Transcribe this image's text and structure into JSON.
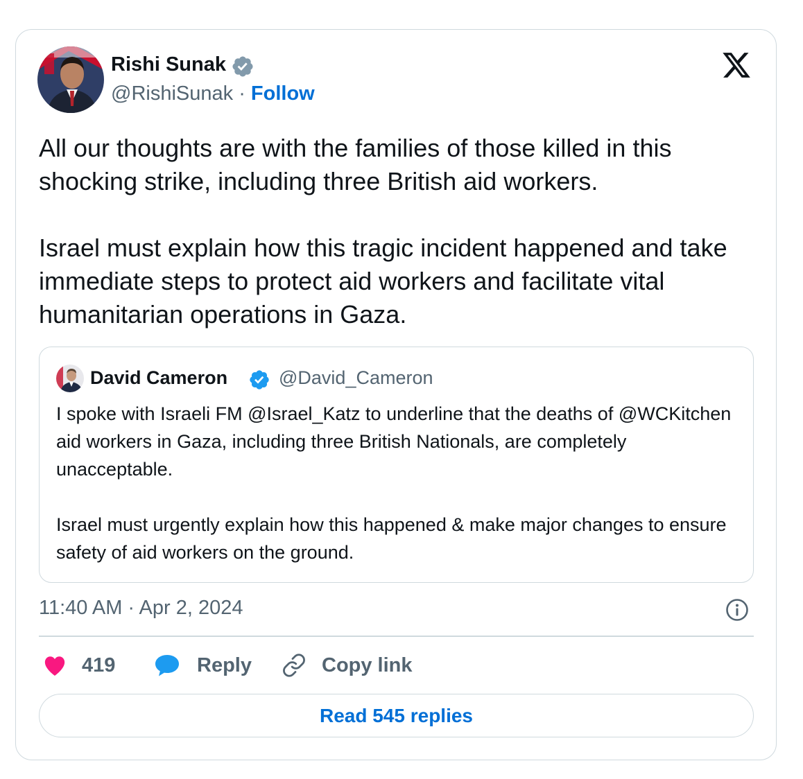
{
  "tweet": {
    "author_name": "Rishi Sunak",
    "handle": "@RishiSunak",
    "separator": "·",
    "follow_label": "Follow",
    "paragraphs": [
      "All our thoughts are with the families of those killed in this shocking strike, including three British aid workers.",
      "Israel must explain how this tragic incident happened and take immediate steps to protect aid workers and facilitate vital humanitarian operations in Gaza."
    ],
    "timestamp": "11:40 AM · Apr 2, 2024"
  },
  "quoted_tweet": {
    "author_name": "David Cameron",
    "handle": "@David_Cameron",
    "paragraphs": [
      "I spoke with Israeli FM @Israel_Katz to underline that the deaths of @WCKitchen aid workers in Gaza, including three British Nationals, are completely unacceptable.",
      "Israel must urgently explain how this happened & make major changes to ensure safety of aid workers on the ground."
    ]
  },
  "actions": {
    "like_count": "419",
    "reply_label": "Reply",
    "copy_link_label": "Copy link"
  },
  "read_replies_label": "Read 545 replies",
  "icons": {
    "verified": "verified-badge-icon",
    "x_logo": "x-logo-icon",
    "info": "info-icon",
    "heart": "heart-icon",
    "reply": "reply-bubble-icon",
    "link": "link-icon"
  },
  "colors": {
    "accent": "#006fd6",
    "verified": "#1d9bf0",
    "heart": "#f91880",
    "muted": "#536471",
    "border": "#cfd9de"
  }
}
